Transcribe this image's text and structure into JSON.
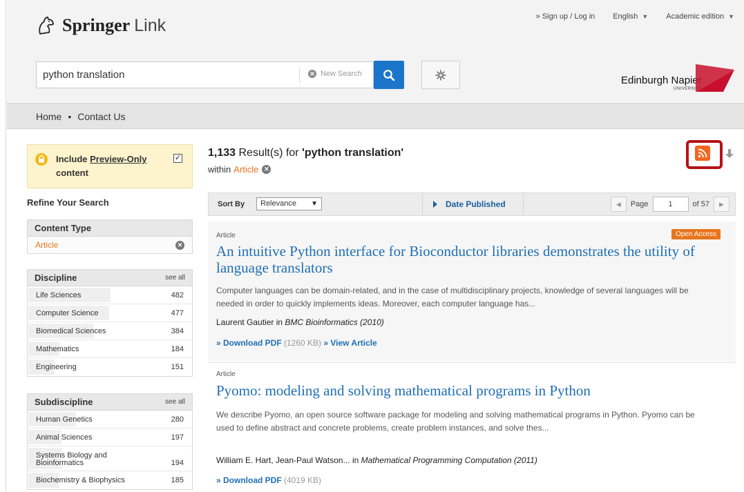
{
  "header": {
    "brand_main": "Springer",
    "brand_link": "Link",
    "top_links": {
      "signup": "» Sign up / Log in",
      "language": "English",
      "edition": "Academic edition"
    },
    "search": {
      "value": "python translation",
      "new_search": "New Search"
    },
    "institution": {
      "name": "Edinburgh Napier",
      "sub": "UNIVERSITY",
      "accent_color": "#c8102e"
    }
  },
  "nav": {
    "home": "Home",
    "separator": "•",
    "contact": "Contact Us"
  },
  "sidebar": {
    "preview": {
      "label_1": "Include ",
      "label_link": "Preview-Only",
      "label_2": "content",
      "checked_mark": "☑"
    },
    "refine_title": "Refine Your Search",
    "content_type": {
      "title": "Content Type",
      "active": "Article"
    },
    "discipline": {
      "title": "Discipline",
      "see_all": "see all",
      "items": [
        {
          "label": "Life Sciences",
          "count": "482",
          "fill": 0.5
        },
        {
          "label": "Computer Science",
          "count": "477",
          "fill": 0.49
        },
        {
          "label": "Biomedical Sciences",
          "count": "384",
          "fill": 0.4
        },
        {
          "label": "Mathematics",
          "count": "184",
          "fill": 0.19
        },
        {
          "label": "Engineering",
          "count": "151",
          "fill": 0.16
        }
      ]
    },
    "subdiscipline": {
      "title": "Subdiscipline",
      "see_all": "see all",
      "items": [
        {
          "label": "Human Genetics",
          "count": "280",
          "fill": 0.29
        },
        {
          "label": "Animal Sciences",
          "count": "197",
          "fill": 0.2
        },
        {
          "label": "Systems Biology and Bioinformatics",
          "count": "194",
          "fill": 0.2
        },
        {
          "label": "Biochemistry & Biophysics",
          "count": "185",
          "fill": 0.19
        }
      ]
    }
  },
  "results": {
    "count": "1,133",
    "count_suffix": " Result(s) for ",
    "query": "'python translation'",
    "within_label": "within",
    "within_value": "Article",
    "sort": {
      "label": "Sort By",
      "selected": "Relevance",
      "date_published": "Date Published"
    },
    "pager": {
      "page_label": "Page",
      "page": "1",
      "of": "of 57"
    },
    "items": [
      {
        "type": "Article",
        "badge": "Open Access",
        "title": "An intuitive Python interface for Bioconductor libraries demonstrates the utility of language translators",
        "description": "Computer languages can be domain-related, and in the case of multidisciplinary projects, knowledge of several languages will be needed in order to quickly implements ideas. Moreover, each computer language has...",
        "authors": "Laurent Gautier in ",
        "journal": "BMC Bioinformatics (2010)",
        "download": "» Download PDF",
        "size": " (1260 KB)",
        "view": " » View Article"
      },
      {
        "type": "Article",
        "title": "Pyomo: modeling and solving mathematical programs in Python",
        "description": "We describe Pyomo, an open source software package for modeling and solving mathematical programs in Python. Pyomo can be used to define abstract and concrete problems, create problem instances, and solve thes...",
        "authors": "William E. Hart, Jean-Paul Watson... in ",
        "journal": "Mathematical Programming Computation (2011)",
        "download": "» Download PDF",
        "size": " (4019 KB)"
      }
    ]
  },
  "colors": {
    "accent_orange": "#e8741c",
    "link_blue": "#1f6fb3",
    "search_blue": "#1b76c9",
    "highlight_red": "#b5121b",
    "rss_orange": "#f26522"
  },
  "icons": {
    "rss": "rss-icon",
    "download": "download-icon",
    "search": "search-icon",
    "gear": "gear-icon",
    "lock": "lock-icon"
  }
}
